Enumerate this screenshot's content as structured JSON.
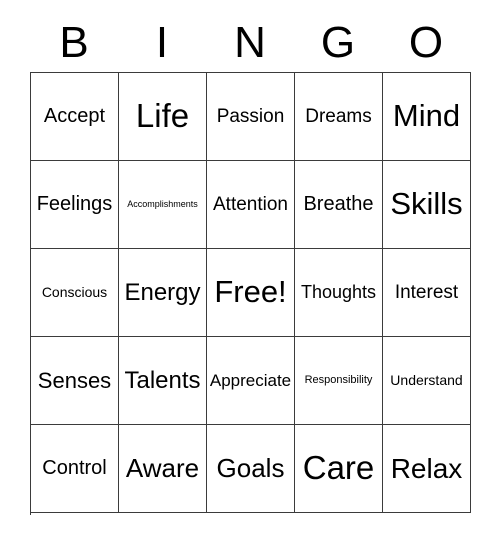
{
  "card": {
    "type": "bingo-card",
    "columns": 5,
    "rows": 5,
    "background_color": "#ffffff",
    "text_color": "#000000",
    "border_color": "#3b3b3b"
  },
  "header": {
    "letters": [
      "B",
      "I",
      "N",
      "G",
      "O"
    ]
  },
  "grid": {
    "free_space": "Free!",
    "free_space_position": {
      "row": 3,
      "column": 3
    },
    "rows": [
      {
        "cells": [
          {
            "label": "Accept",
            "size": "fs-20"
          },
          {
            "label": "Life",
            "size": "fs-33"
          },
          {
            "label": "Passion",
            "size": "fs-19"
          },
          {
            "label": "Dreams",
            "size": "fs-19"
          },
          {
            "label": "Mind",
            "size": "fs-31"
          }
        ]
      },
      {
        "cells": [
          {
            "label": "Feelings",
            "size": "fs-20"
          },
          {
            "label": "Accomplishments",
            "size": "fs-9"
          },
          {
            "label": "Attention",
            "size": "fs-19"
          },
          {
            "label": "Breathe",
            "size": "fs-20"
          },
          {
            "label": "Skills",
            "size": "fs-31"
          }
        ]
      },
      {
        "cells": [
          {
            "label": "Conscious",
            "size": "fs-14"
          },
          {
            "label": "Energy",
            "size": "fs-24"
          },
          {
            "label": "Free!",
            "size": "fs-31"
          },
          {
            "label": "Thoughts",
            "size": "fs-18"
          },
          {
            "label": "Interest",
            "size": "fs-19"
          }
        ]
      },
      {
        "cells": [
          {
            "label": "Senses",
            "size": "fs-22"
          },
          {
            "label": "Talents",
            "size": "fs-24"
          },
          {
            "label": "Appreciate",
            "size": "fs-17"
          },
          {
            "label": "Responsibility",
            "size": "fs-11"
          },
          {
            "label": "Understand",
            "size": "fs-14"
          }
        ]
      },
      {
        "cells": [
          {
            "label": "Control",
            "size": "fs-20"
          },
          {
            "label": "Aware",
            "size": "fs-26"
          },
          {
            "label": "Goals",
            "size": "fs-26"
          },
          {
            "label": "Care",
            "size": "fs-33"
          },
          {
            "label": "Relax",
            "size": "fs-28"
          }
        ]
      }
    ]
  }
}
